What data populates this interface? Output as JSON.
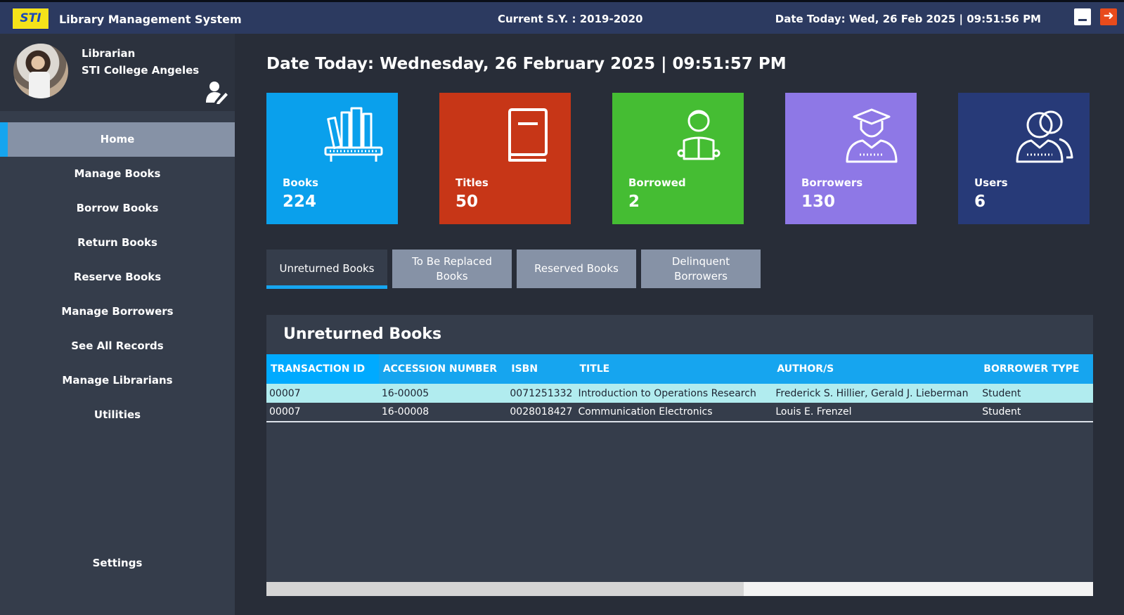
{
  "titlebar": {
    "logo_text": "STI",
    "title": "Library Management System",
    "school_year": "Current S.Y. : 2019-2020",
    "date_time": "Date Today: Wed, 26 Feb 2025 | 09:51:56 PM"
  },
  "profile": {
    "role": "Librarian",
    "school": "STI College Angeles"
  },
  "nav": {
    "items": [
      {
        "label": "Home"
      },
      {
        "label": "Manage Books"
      },
      {
        "label": "Borrow Books"
      },
      {
        "label": "Return Books"
      },
      {
        "label": "Reserve Books"
      },
      {
        "label": "Manage Borrowers"
      },
      {
        "label": "See All Records"
      },
      {
        "label": "Manage Librarians"
      },
      {
        "label": "Utilities"
      }
    ],
    "settings": "Settings"
  },
  "main": {
    "date_heading": "Date Today: Wednesday, 26 February 2025 | 09:51:57 PM"
  },
  "cards": [
    {
      "label": "Books",
      "value": "224",
      "icon": "bookshelf-icon",
      "color": "#0aa0ec"
    },
    {
      "label": "Titles",
      "value": "50",
      "icon": "book-icon",
      "color": "#c73617"
    },
    {
      "label": "Borrowed",
      "value": "2",
      "icon": "reader-icon",
      "color": "#45bd33"
    },
    {
      "label": "Borrowers",
      "value": "130",
      "icon": "student-icon",
      "color": "#8e78e6"
    },
    {
      "label": "Users",
      "value": "6",
      "icon": "users-icon",
      "color": "#273a78"
    }
  ],
  "tabs": [
    {
      "label": "Unreturned Books"
    },
    {
      "label": "To Be Replaced Books"
    },
    {
      "label": "Reserved Books"
    },
    {
      "label": "Delinquent Borrowers"
    }
  ],
  "panel": {
    "title": "Unreturned Books",
    "columns": [
      "TRANSACTION ID",
      "ACCESSION NUMBER",
      "ISBN",
      "TITLE",
      "AUTHOR/S",
      "BORROWER TYPE"
    ],
    "rows": [
      [
        "00007",
        "16-00005",
        "0071251332",
        "Introduction to Operations Research",
        "Frederick S. Hillier, Gerald J. Lieberman",
        "Student"
      ],
      [
        "00007",
        "16-00008",
        "0028018427",
        "Communication Electronics",
        "Louis E. Frenzel",
        "Student"
      ]
    ]
  }
}
